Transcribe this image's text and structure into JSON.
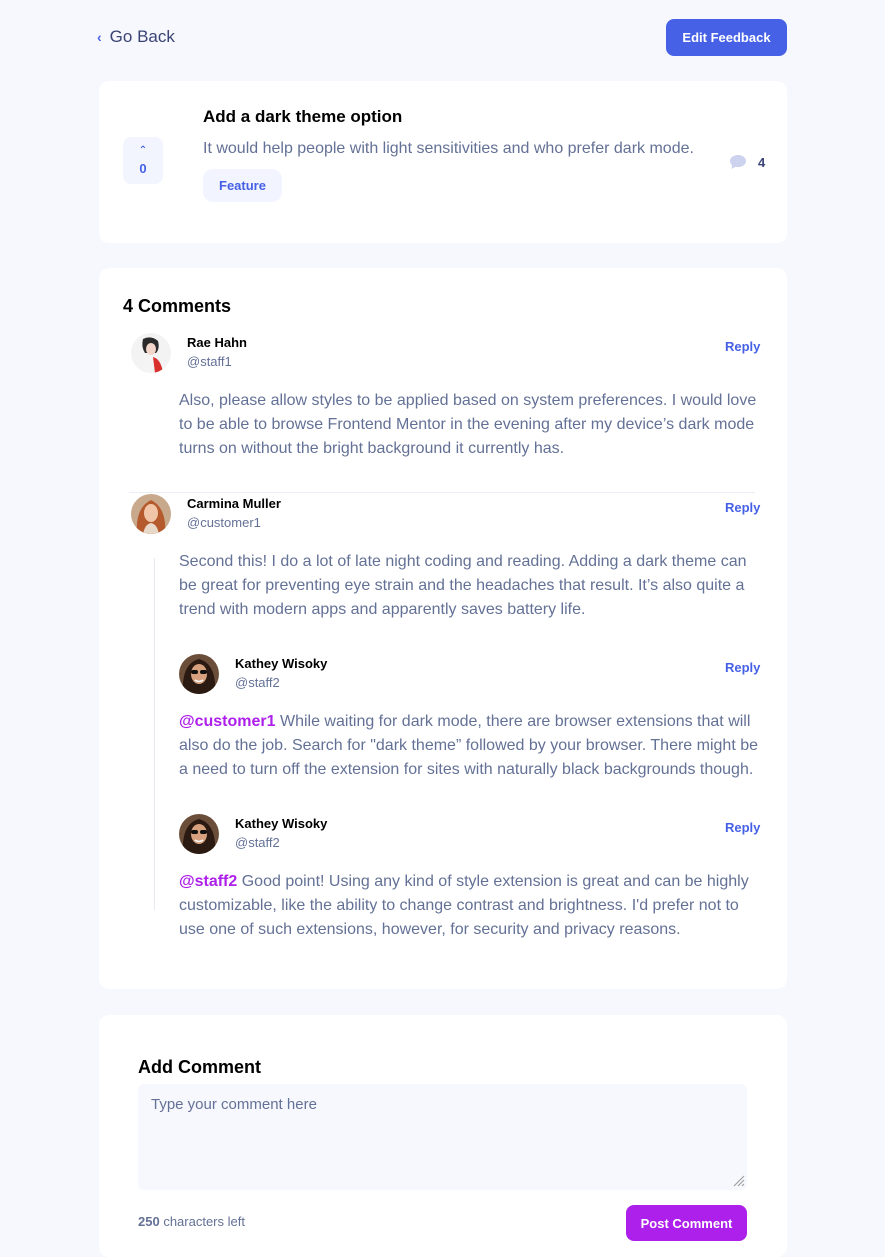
{
  "nav": {
    "back_label": "Go Back",
    "edit_label": "Edit Feedback"
  },
  "feedback": {
    "title": "Add a dark theme option",
    "description": "It would help people with light sensitivities and who prefer dark mode.",
    "category": "Feature",
    "upvotes": "0",
    "comment_count": "4"
  },
  "comments": {
    "heading": "4 Comments",
    "items": [
      {
        "name": "Rae Hahn",
        "handle": "@staff1",
        "reply_label": "Reply",
        "body": "Also, please allow styles to be applied based on system preferences. I would love to be able to browse Frontend Mentor in the evening after my device’s dark mode turns on without the bright background it currently has."
      },
      {
        "name": "Carmina Muller",
        "handle": "@customer1",
        "reply_label": "Reply",
        "body": "Second this! I do a lot of late night coding and reading. Adding a dark theme can be great for preventing eye strain and the headaches that result. It’s also quite a trend with modern apps and apparently saves battery life.",
        "replies": [
          {
            "name": "Kathey Wisoky",
            "handle": "@staff2",
            "reply_label": "Reply",
            "mention": "@customer1",
            "body": " While waiting for dark mode, there are browser extensions that will also do the job. Search for \"dark theme” followed by your browser. There might be a need to turn off the extension for sites with naturally black backgrounds though."
          },
          {
            "name": "Kathey Wisoky",
            "handle": "@staff2",
            "reply_label": "Reply",
            "mention": "@staff2",
            "body": " Good point! Using any kind of style extension is great and can be highly customizable, like the ability to change contrast and brightness. I'd prefer not to use one of such extensions, however, for security and privacy reasons."
          }
        ]
      }
    ]
  },
  "add_comment": {
    "title": "Add Comment",
    "placeholder": "Type your comment here",
    "chars_count": "250",
    "chars_suffix": " characters left",
    "post_label": "Post Comment"
  },
  "colors": {
    "primary": "#4661e6",
    "accent": "#ad1fea",
    "text_dark": "#3a4374",
    "text_muted": "#647196"
  }
}
